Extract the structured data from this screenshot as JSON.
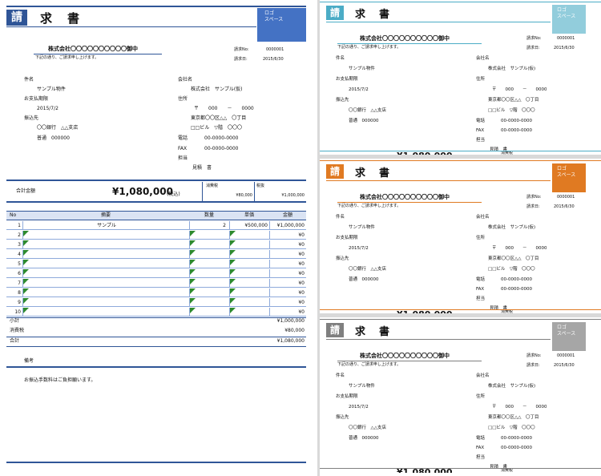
{
  "colors": {
    "main": "#2f5597",
    "teal": "#4bacc6",
    "orange": "#e07a22",
    "gray": "#7f7f7f",
    "sky": "#92cddc",
    "logo_blue": "#4472c4",
    "logo_orange": "#e07a22",
    "logo_gray": "#a6a6a6",
    "triangle": "#2e8b2e"
  },
  "main": {
    "kei": "請",
    "title": "求　書",
    "logo": [
      "ロゴ",
      "スペース"
    ],
    "addressee": "株式会社〇〇〇〇〇〇〇〇〇〇御中",
    "greeting": "下記の通り、ご請求申し上げます。",
    "invoice_no_label": "請求No:",
    "invoice_no": "0000001",
    "invoice_date_label": "請求日:",
    "invoice_date": "2015/6/30",
    "subject_label": "件名",
    "subject": "サンプル物件",
    "due_label": "お支払期限",
    "due": "2015/7/2",
    "bank_label": "振込先",
    "bank": "〇〇銀行　△△支店",
    "account": "普通　000000",
    "company_label": "会社名",
    "company": "株式会社　サンプル(仮)",
    "address_label": "住所",
    "postal": "〒　　000　　－　　0000",
    "address1": "東京都〇〇区△△　〇丁目",
    "address2": "□□ビル　▽階　〇〇〇",
    "tel_label": "電話",
    "tel": "00-0000-0000",
    "fax_label": "FAX",
    "fax": "00-0000-0000",
    "person_label": "担当",
    "person": "見積　書",
    "total_label": "合計金額",
    "total_amount": "¥1,080,000",
    "total_tax_note": "(税込)",
    "tax_label": "消費税",
    "tax_value": "¥80,000",
    "pretax_label": "税抜",
    "pretax_value": "¥1,000,000",
    "table_headers": [
      "No",
      "摘要",
      "数量",
      "単価",
      "金額"
    ],
    "rows": [
      {
        "no": "1",
        "desc": "サンプル",
        "qty": "2",
        "price": "¥500,000",
        "amount": "¥1,000,000"
      },
      {
        "no": "2",
        "desc": "",
        "qty": "",
        "price": "",
        "amount": "¥0"
      },
      {
        "no": "3",
        "desc": "",
        "qty": "",
        "price": "",
        "amount": "¥0"
      },
      {
        "no": "4",
        "desc": "",
        "qty": "",
        "price": "",
        "amount": "¥0"
      },
      {
        "no": "5",
        "desc": "",
        "qty": "",
        "price": "",
        "amount": "¥0"
      },
      {
        "no": "6",
        "desc": "",
        "qty": "",
        "price": "",
        "amount": "¥0"
      },
      {
        "no": "7",
        "desc": "",
        "qty": "",
        "price": "",
        "amount": "¥0"
      },
      {
        "no": "8",
        "desc": "",
        "qty": "",
        "price": "",
        "amount": "¥0"
      },
      {
        "no": "9",
        "desc": "",
        "qty": "",
        "price": "",
        "amount": "¥0"
      },
      {
        "no": "10",
        "desc": "",
        "qty": "",
        "price": "",
        "amount": "¥0"
      }
    ],
    "subtotal_label": "小計",
    "subtotal_value": "¥1,000,000",
    "ctax_label": "消費税",
    "ctax_value": "¥80,000",
    "grand_label": "合計",
    "grand_value": "¥1,080,000",
    "remarks_label": "備考",
    "remarks": "お振込手数料はご負担願います。"
  },
  "thumb_cut_amount": "¥1,080,000",
  "thumb_cut_tax": "消費税"
}
